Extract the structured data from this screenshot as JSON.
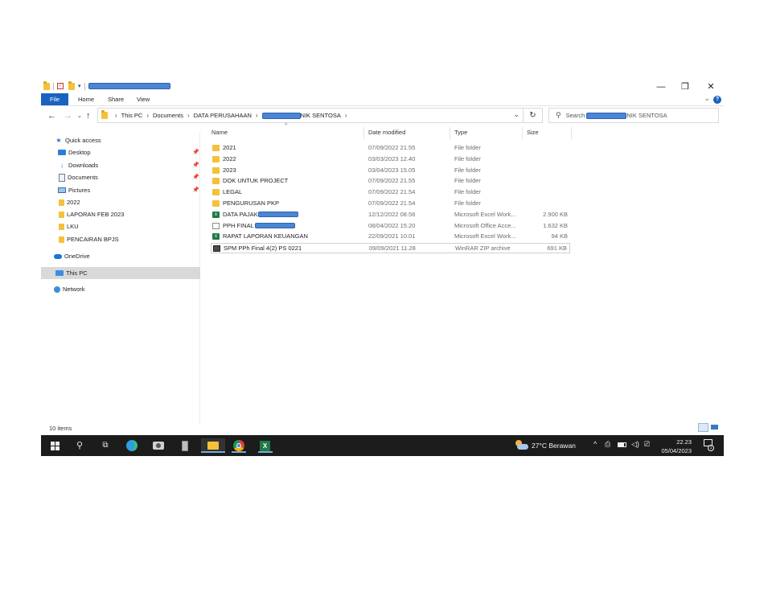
{
  "window": {
    "controls": {
      "minimize": "—",
      "maximize": "❐",
      "close": "✕"
    },
    "help": "?"
  },
  "ribbon": {
    "tabs": [
      "File",
      "Home",
      "Share",
      "View"
    ],
    "collapse_icon": "chevron-down-icon"
  },
  "address": {
    "segments": [
      "This PC",
      "Documents",
      "DATA PERUSAHAAN",
      "NIK SENTOSA"
    ],
    "search_label": "Search",
    "search_suffix": "NIK SENTOSA"
  },
  "nav_pane": {
    "items": [
      {
        "label": "Quick access",
        "icon": "star-icon"
      },
      {
        "label": "Desktop",
        "icon": "desktop-icon",
        "pinned": true
      },
      {
        "label": "Downloads",
        "icon": "download-icon",
        "pinned": true
      },
      {
        "label": "Documents",
        "icon": "documents-icon",
        "pinned": true
      },
      {
        "label": "Pictures",
        "icon": "pictures-icon",
        "pinned": true
      },
      {
        "label": "2022",
        "icon": "folder-icon"
      },
      {
        "label": "LAPORAN FEB 2023",
        "icon": "folder-icon"
      },
      {
        "label": "LKU",
        "icon": "folder-icon"
      },
      {
        "label": "PENCAIRAN BPJS",
        "icon": "folder-icon"
      },
      {
        "label": "OneDrive",
        "icon": "cloud-icon"
      },
      {
        "label": "This PC",
        "icon": "computer-icon",
        "selected": true
      },
      {
        "label": "Network",
        "icon": "network-icon"
      }
    ]
  },
  "columns": [
    "Name",
    "Date modified",
    "Type",
    "Size"
  ],
  "files": [
    {
      "name": "2021",
      "date": "07/09/2022 21.55",
      "type": "File folder",
      "size": "",
      "icon": "folder-icon"
    },
    {
      "name": "2022",
      "date": "03/03/2023 12.40",
      "type": "File folder",
      "size": "",
      "icon": "folder-icon"
    },
    {
      "name": "2023",
      "date": "03/04/2023 15.05",
      "type": "File folder",
      "size": "",
      "icon": "folder-icon"
    },
    {
      "name": "DOK UNTUK PROJECT",
      "date": "07/09/2022 21.55",
      "type": "File folder",
      "size": "",
      "icon": "folder-icon"
    },
    {
      "name": "LEGAL",
      "date": "07/09/2022 21.54",
      "type": "File folder",
      "size": "",
      "icon": "folder-icon"
    },
    {
      "name": "PENGURUSAN PKP",
      "date": "07/09/2022 21.54",
      "type": "File folder",
      "size": "",
      "icon": "folder-icon"
    },
    {
      "name": "DATA PAJAK",
      "date": "12/12/2022 08.56",
      "type": "Microsoft Excel Work...",
      "size": "2.900 KB",
      "icon": "excel-icon"
    },
    {
      "name": "PPH FINAL",
      "date": "08/04/2022 15.20",
      "type": "Microsoft Office Acce...",
      "size": "1.632 KB",
      "icon": "access-icon"
    },
    {
      "name": "RAPAT LAPORAN KEUANGAN",
      "date": "22/09/2021 10.01",
      "type": "Microsoft Excel Work...",
      "size": "94 KB",
      "icon": "excel-icon"
    },
    {
      "name": "SPM PPh Final 4(2) PS 0221",
      "date": "09/09/2021 11.28",
      "type": "WinRAR ZIP archive",
      "size": "691 KB",
      "icon": "zip-icon"
    }
  ],
  "status": {
    "item_count": "10 items"
  },
  "taskbar": {
    "weather": "27°C  Berawan",
    "time": "22.23",
    "date": "05/04/2023",
    "notification_count": "1"
  }
}
